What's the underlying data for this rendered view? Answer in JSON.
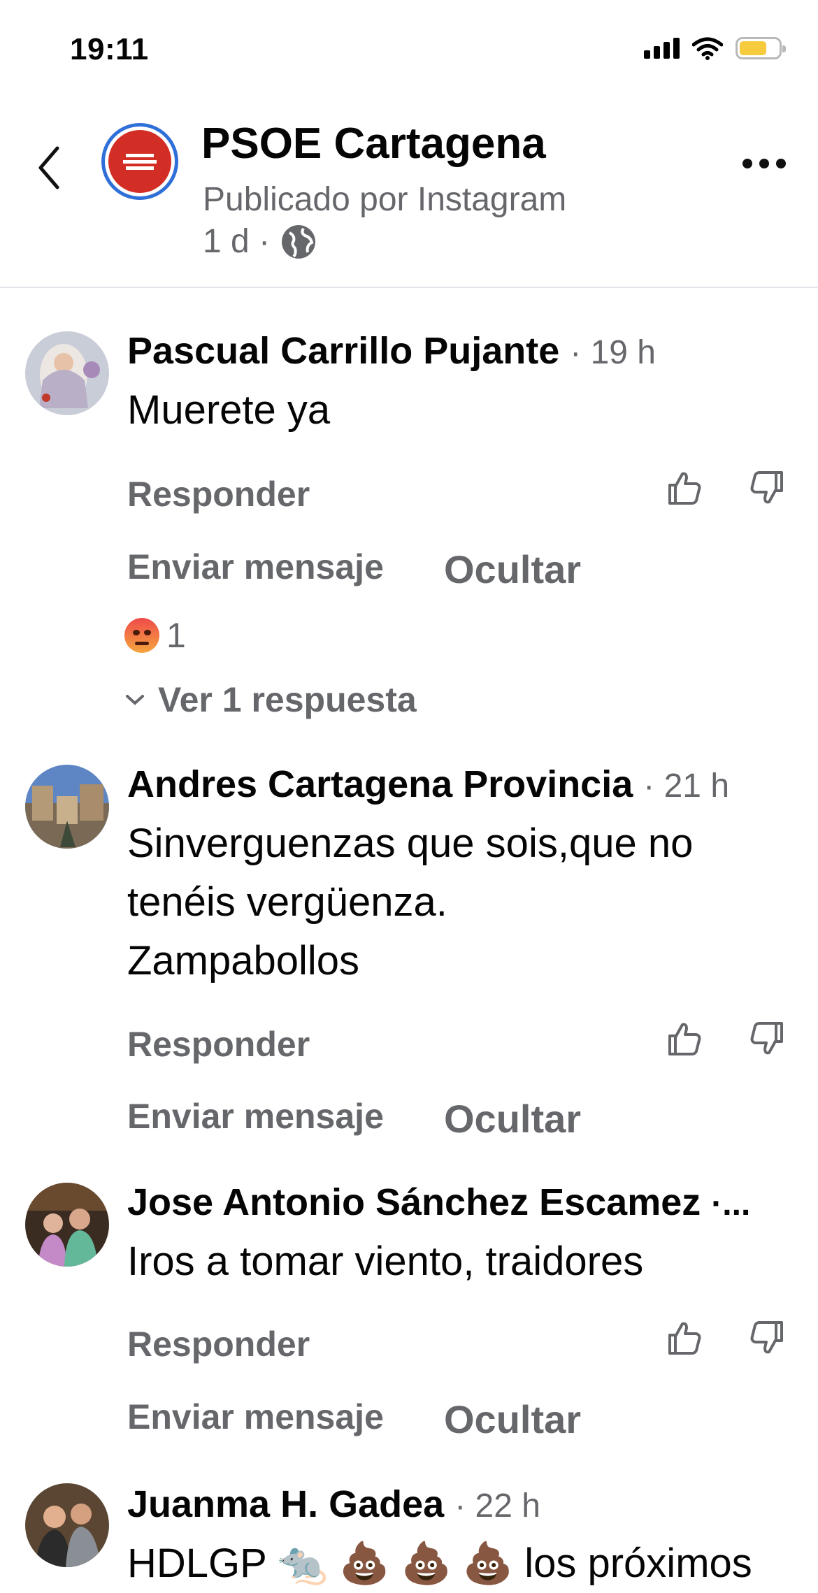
{
  "status_bar": {
    "time": "19:11"
  },
  "header": {
    "page_name": "PSOE Cartagena",
    "subtitle": "Publicado por Instagram",
    "post_time": "1 d ·"
  },
  "comments": [
    {
      "author": "Pascual Carrillo Pujante",
      "meta": "· 19 h",
      "text": "Muerete ya",
      "reply": "Responder",
      "message": "Enviar mensaje",
      "hide": "Ocultar",
      "reaction_count": "1",
      "view_replies": "Ver 1 respuesta"
    },
    {
      "author": "Andres Cartagena Provincia",
      "meta": "· 21 h",
      "text_lines": [
        "Sinverguenzas que sois,que no",
        "tenéis vergüenza.",
        "Zampabollos"
      ],
      "reply": "Responder",
      "message": "Enviar mensaje",
      "hide": "Ocultar"
    },
    {
      "author": "Jose Antonio Sánchez Escamez",
      "meta": "·...",
      "text": "Iros a tomar viento, traidores",
      "reply": "Responder",
      "message": "Enviar mensaje",
      "hide": "Ocultar"
    },
    {
      "author": "Juanma H. Gadea",
      "meta": "· 22 h",
      "text": "HDLGP 🐀 💩 💩 💩 los próximos"
    }
  ],
  "colors": {
    "accent_blue": "#2f6fd8",
    "brand_red": "#d32e25",
    "secondary_text": "#65676b"
  },
  "icons": [
    "back-chevron-icon",
    "globe-icon",
    "more-icon",
    "like-icon",
    "dislike-icon",
    "angry-reaction-icon",
    "chevron-down-icon"
  ]
}
